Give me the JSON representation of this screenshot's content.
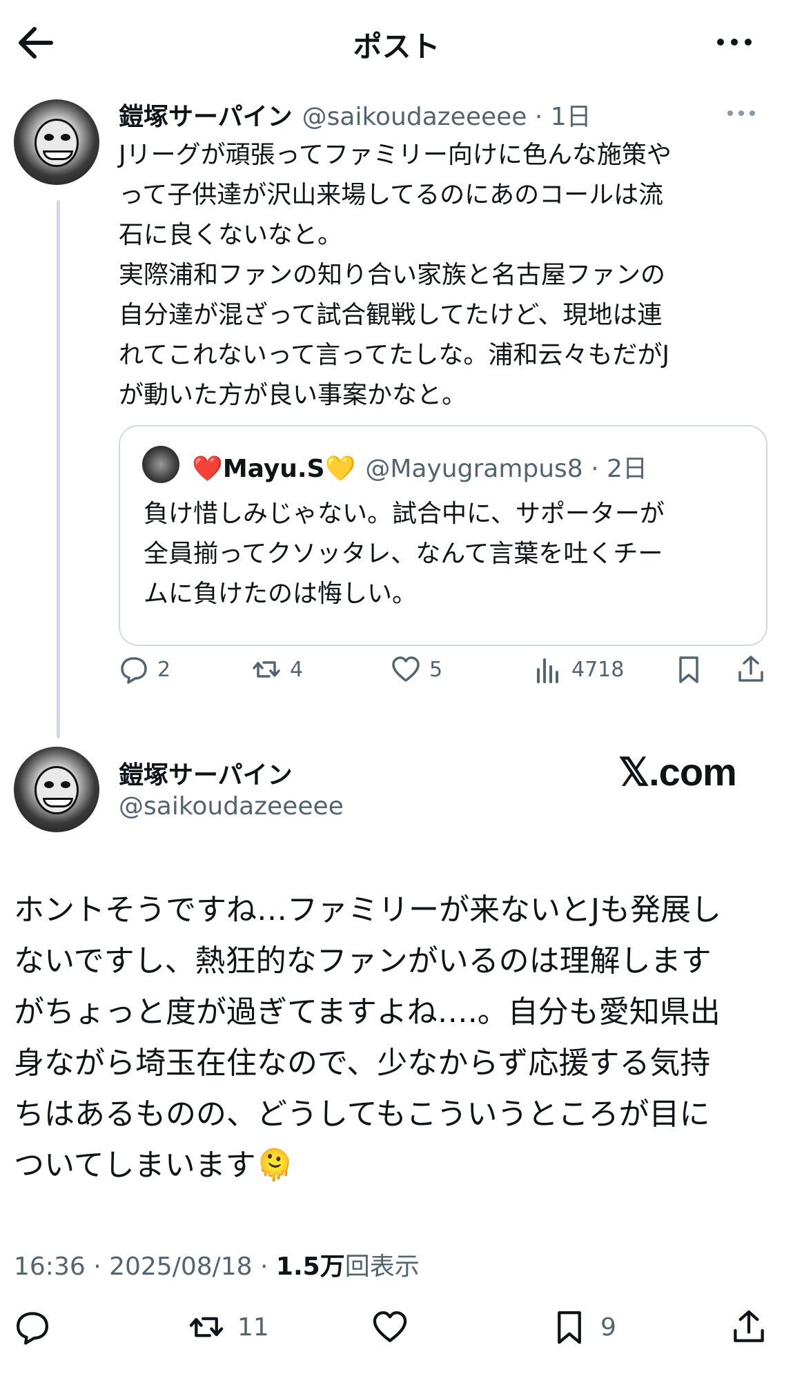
{
  "header": {
    "title": "ポスト"
  },
  "original_post": {
    "display_name": "鎧塚サーパイン",
    "handle_time": "@saikoudazeeeee · 1日",
    "text": "Jリーグが頑張ってファミリー向けに色んな施策や\nって子供達が沢山来場してるのにあのコールは流\n石に良くないなと。\n実際浦和ファンの知り合い家族と名古屋ファンの\n自分達が混ざって試合観戦してたけど、現地は連\nれてこれないって言ってたしな。浦和云々もだがJ\nが動いた方が良い事案かなと。",
    "quote": {
      "display_name": "❤️Mayu.S💛",
      "handle_time": "@Mayugrampus8 · 2日",
      "text": "負け惜しみじゃない。試合中に、サポーターが\n全員揃ってクソッタレ、なんて言葉を吐くチー\nムに負けたのは悔しい。"
    },
    "actions": {
      "replies": "2",
      "reposts": "4",
      "likes": "5",
      "views": "4718"
    }
  },
  "reply_post": {
    "display_name": "鎧塚サーパイン",
    "handle": "@saikoudazeeeee",
    "badge": "𝕏.com",
    "text": "ホントそうですね…ファミリーが来ないとJも発展し\nないですし、熱狂的なファンがいるのは理解します\nがちょっと度が過ぎてますよね….。自分も愛知県出\n身ながら埼玉在住なので、少なからず応援する気持\nちはあるものの、どうしてもこういうところが目に\nついてしまいます🫠",
    "timestamp": "16:36 · 2025/08/18 · ",
    "views_count": "1.5万",
    "views_label": "回表示",
    "actions": {
      "reposts": "11",
      "bookmarks": "9"
    }
  },
  "colors": {
    "text": "#0f1419",
    "muted": "#536471",
    "border": "#cfd9de"
  },
  "icons": [
    "back-arrow-icon",
    "more-icon",
    "reply-icon",
    "repost-icon",
    "like-icon",
    "views-icon",
    "bookmark-icon",
    "share-icon"
  ]
}
